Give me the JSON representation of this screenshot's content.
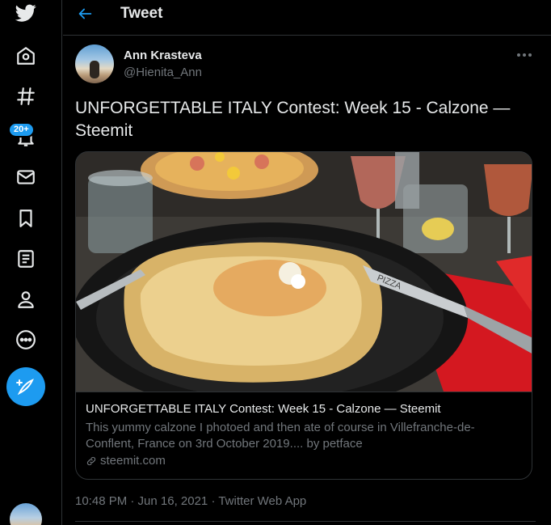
{
  "nav": {
    "items": [
      {
        "name": "twitter-logo-icon"
      },
      {
        "name": "home-icon"
      },
      {
        "name": "explore-hashtag-icon"
      },
      {
        "name": "notifications-bell-icon"
      },
      {
        "name": "messages-envelope-icon"
      },
      {
        "name": "bookmarks-icon"
      },
      {
        "name": "lists-icon"
      },
      {
        "name": "profile-icon"
      },
      {
        "name": "more-circle-icon"
      }
    ],
    "notification_badge": "20+",
    "compose_icon": "feather-plus-icon",
    "accent_color": "#1d9bf0"
  },
  "header": {
    "title": "Tweet",
    "back_icon": "arrow-left-icon"
  },
  "tweet": {
    "author_name": "Ann Krasteva",
    "author_handle": "@Hienita_Ann",
    "text": "UNFORGETTABLE ITALY Contest: Week 15 - Calzone — Steemit",
    "card": {
      "title": "UNFORGETTABLE ITALY Contest: Week 15 - Calzone — Steemit",
      "description": "This yummy calzone I photoed and then ate of course in Villefranche-de-Conflent, France on 3rd October 2019.... by petface",
      "domain": "steemit.com",
      "image_alt": "calzone on black plate with pizza knife and wine glasses",
      "knife_label": "PIZZA"
    },
    "timestamp": "10:48 PM · Jun 16, 2021 · Twitter Web App"
  }
}
